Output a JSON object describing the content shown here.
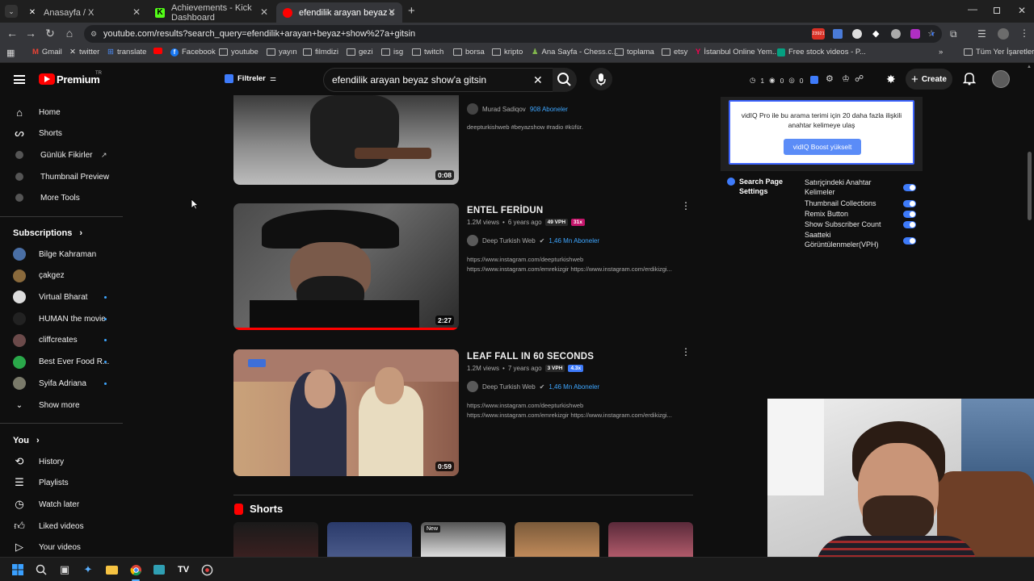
{
  "browser": {
    "tabs": [
      {
        "title": "Anasayfa / X",
        "active": false
      },
      {
        "title": "Achievements - Kick Dashboard",
        "active": false
      },
      {
        "title": "efendilik arayan beyaz show'a g",
        "active": true
      }
    ],
    "url": "youtube.com/results?search_query=efendilik+arayan+beyaz+show%27a+gitsin",
    "bookmarks": [
      "Gmail",
      "twitter",
      "translate",
      "Facebook",
      "youtube",
      "yayın",
      "filmdizi",
      "gezi",
      "isg",
      "twitch",
      "borsa",
      "kripto",
      "Ana Sayfa - Chess.c...",
      "toplama",
      "etsy",
      "İstanbul Online Yem...",
      "Free stock videos - P...",
      "Tüm Yer İşaretleri"
    ],
    "notification_badge": "23921"
  },
  "masthead": {
    "logo_text": "Premium",
    "logo_country": "TR",
    "filter_label": "Filtreler",
    "search_value": "efendilik arayan beyaz show'a gitsin",
    "create_label": "Create",
    "vidiq_counts": [
      "1",
      "0",
      "0"
    ]
  },
  "sidebar": {
    "main": [
      {
        "label": "Home",
        "icon": "home-icon"
      },
      {
        "label": "Shorts",
        "icon": "shorts-icon"
      },
      {
        "label": "Günlük Fikirler",
        "icon": "vidiq-icon"
      },
      {
        "label": "Thumbnail Preview",
        "icon": "vidiq-icon"
      },
      {
        "label": "More Tools",
        "icon": "vidiq-icon"
      }
    ],
    "subscriptions_title": "Subscriptions",
    "subscriptions": [
      {
        "label": "Bilge Kahraman",
        "dot": false,
        "color": "#4a6fa5"
      },
      {
        "label": "çakgez",
        "dot": false,
        "color": "#8a6a3c"
      },
      {
        "label": "Virtual Bharat",
        "dot": true,
        "color": "#dddddd"
      },
      {
        "label": "HUMAN the movie",
        "dot": true,
        "color": "#222222"
      },
      {
        "label": "cliffcreates",
        "dot": true,
        "color": "#6b4a4a"
      },
      {
        "label": "Best Ever Food R...",
        "dot": true,
        "color": "#2aa84a"
      },
      {
        "label": "Syifa Adriana",
        "dot": true,
        "color": "#7a7a6a"
      }
    ],
    "show_more": "Show more",
    "you_title": "You",
    "you_items": [
      {
        "label": "History",
        "icon": "history-icon"
      },
      {
        "label": "Playlists",
        "icon": "playlists-icon"
      },
      {
        "label": "Watch later",
        "icon": "watch-later-icon"
      },
      {
        "label": "Liked videos",
        "icon": "like-icon"
      },
      {
        "label": "Your videos",
        "icon": "your-videos-icon"
      }
    ]
  },
  "results": [
    {
      "title": "",
      "duration": "0:08",
      "channel": "Murad Sadiqov",
      "subs": "908 Aboneler",
      "desc": [
        "deepturkishweb #beyazshow #radio #küfür."
      ]
    },
    {
      "title": "ENTEL FERİDUN",
      "views": "1.2M views",
      "age": "6 years ago",
      "vph": "49 VPH",
      "mult": "31x",
      "mult_color": "#c4156b",
      "duration": "2:27",
      "channel": "Deep Turkish Web",
      "subs": "1,46 Mn Aboneler",
      "desc": [
        "https://www.instagram.com/deepturkishweb",
        "https://www.instagram.com/emrekizgir https://www.instagram.com/erdikizgi..."
      ]
    },
    {
      "title": "LEAF FALL IN 60 SECONDS",
      "views": "1.2M views",
      "age": "7 years ago",
      "vph": "3 VPH",
      "mult": "4.3x",
      "mult_color": "#3e7bfa",
      "duration": "0:59",
      "channel": "Deep Turkish Web",
      "subs": "1,46 Mn Aboneler",
      "desc": [
        "https://www.instagram.com/deepturkishweb",
        "https://www.instagram.com/emrekizgir https://www.instagram.com/erdikizgi..."
      ]
    }
  ],
  "shorts": {
    "title": "Shorts",
    "new_badge": "New"
  },
  "vidiq": {
    "promo_text": "vidIQ Pro ile bu arama terimi için 20 daha fazla ilişkili anahtar kelimeye ulaş",
    "promo_button": "vidIQ Boost yükselt",
    "settings_title": "Search Page Settings",
    "settings": [
      "Satırįçindeki Anahtar Kelimeler",
      "Thumbnail Collections",
      "Remix Button",
      "Show Subscriber Count",
      "Saatteki Görüntülenmeler(VPH)"
    ]
  }
}
